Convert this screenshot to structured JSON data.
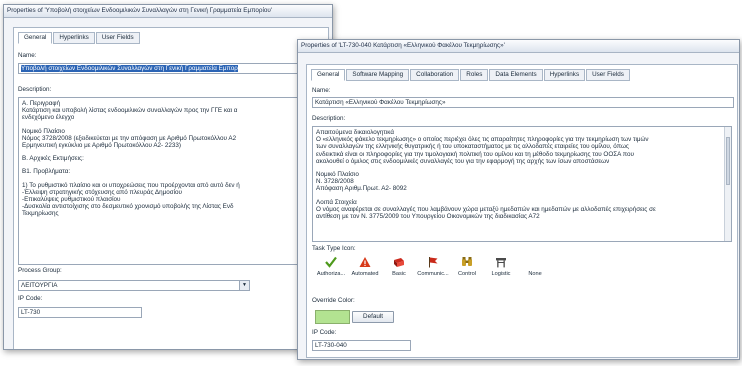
{
  "win1": {
    "title": "Properties of 'Υποβολή στοιχείων Ενδοομιλικών Συναλλαγών στη Γενική Γραμματεία Εμπορίου'",
    "tabs": [
      "General",
      "Hyperlinks",
      "User Fields"
    ],
    "name_label": "Name:",
    "name_value": "Υποβολή στοιχείων Ενδοομιλικών Συναλλαγών στη Γενική Γραμματεία Εμπορ",
    "description_label": "Description:",
    "description_lines": [
      "Α. Περιγραφή",
      "Κατάρτιση και υποβολή λίστας ενδοομιλικών συναλλαγών προς την ΓΓΕ και α",
      "ενδεχόμενο έλεγχο",
      "",
      "Νομικό Πλαίσιο",
      "Νόμος 3728/2008 (εξειδικεύεται με την απόφαση με Αριθμό Πρωτοκόλλου Α2",
      "Ερμηνευτική εγκύκλιο με Αριθμό Πρωτοκόλλου Α2- 2233)",
      "",
      "Β. Αρχικές Εκτιμήσεις:",
      "",
      "Β1. Προβλήματα:",
      "",
      "1) Το ρυθμιστικό πλαίσιο και οι υποχρεώσεις που προέρχονται από αυτό δεν ή",
      "-Έλλειψη στρατηγικής στόχευσης από πλευράς Δημοσίου",
      "-Επικαλύψεις ρυθμιστικού πλαισίου",
      "-Δυσκολία αντιστοίχισης στο δεσμευτικό χρονισμό υποβολής της Λίστας Ενδ",
      "Τεκμηρίωσης"
    ],
    "process_group_label": "Process Group:",
    "process_group_value": "ΛΕΙΤΟΥΡΓΙΑ",
    "ip_code_label": "IP Code:",
    "ip_code_value": "LT-730"
  },
  "win2": {
    "title": "Properties of 'LT-730-040 Κατάρτιση «Ελληνικού Φακέλου Τεκμηρίωσης»'",
    "tabs": [
      "General",
      "Software Mapping",
      "Collaboration",
      "Roles",
      "Data Elements",
      "Hyperlinks",
      "User Fields"
    ],
    "name_label": "Name:",
    "name_value": "Κατάρτιση «Ελληνικού Φακέλου Τεκμηρίωσης»",
    "description_label": "Description:",
    "description_lines": [
      "Απαιτούμενα δικαιολογητικά",
      "Ο «ελληνικός φάκελο τεκμηρίωσης» ο οποίος περιέχει όλες τις απαραίτητες πληροφορίες για την τεκμηρίωση των τιμών",
      "των συναλλαγών της ελληνικής θυγατρικής ή του υποκαταστήματος με τις αλλοδαπές εταιρείες του ομίλου, όπως",
      "ενδεικτικά είναι οι πληροφορίες για την τιμολογιακή πολιτική του ομίλου και τη μέθοδο τεκμηρίωσης του ΟΟΣΑ που",
      "ακολουθεί ο όμιλος στις ενδοομιλικές συναλλαγές του για την εφαρμογή της αρχής των ίσων αποστάσεων",
      "",
      "Νομικό Πλαίσιο",
      "Ν. 3728/2008",
      "Απόφαση Αριθμ.Πρωτ. Α2- 8092",
      "",
      "Λοιπά Στοιχεία",
      "Ο νόμος αναφέρεται σε συναλλαγές που λαμβάνουν χώρα μεταξύ ημεδαπών και ημεδαπών με αλλοδαπές επιχειρήσεις σε",
      "αντίθεση με τον Ν. 3775/2009 του Υπουργείου Οικονομικών της διαδικασίας Α72"
    ],
    "task_type_label": "Task Type Icon:",
    "task_types": [
      {
        "label": "Authoriza...",
        "icon": "checkmark-icon",
        "color": "#4e9a1c"
      },
      {
        "label": "Automated",
        "icon": "warning-triangle-icon",
        "color": "#d83a1a"
      },
      {
        "label": "Basic",
        "icon": "red-book-icon",
        "color": "#cc2a1e"
      },
      {
        "label": "Communic...",
        "icon": "red-flag-icon",
        "color": "#c92a1a"
      },
      {
        "label": "Control",
        "icon": "binoculars-icon",
        "color": "#c9a028"
      },
      {
        "label": "Logistic",
        "icon": "road-sign-icon",
        "color": "#4a4a4a"
      },
      {
        "label": "None",
        "icon": "none",
        "color": "#ffffff"
      }
    ],
    "override_color_label": "Override Color:",
    "override_color": "#b3e391",
    "default_button": "Default",
    "ip_code_label": "IP Code:",
    "ip_code_value": "LT-730-040"
  }
}
